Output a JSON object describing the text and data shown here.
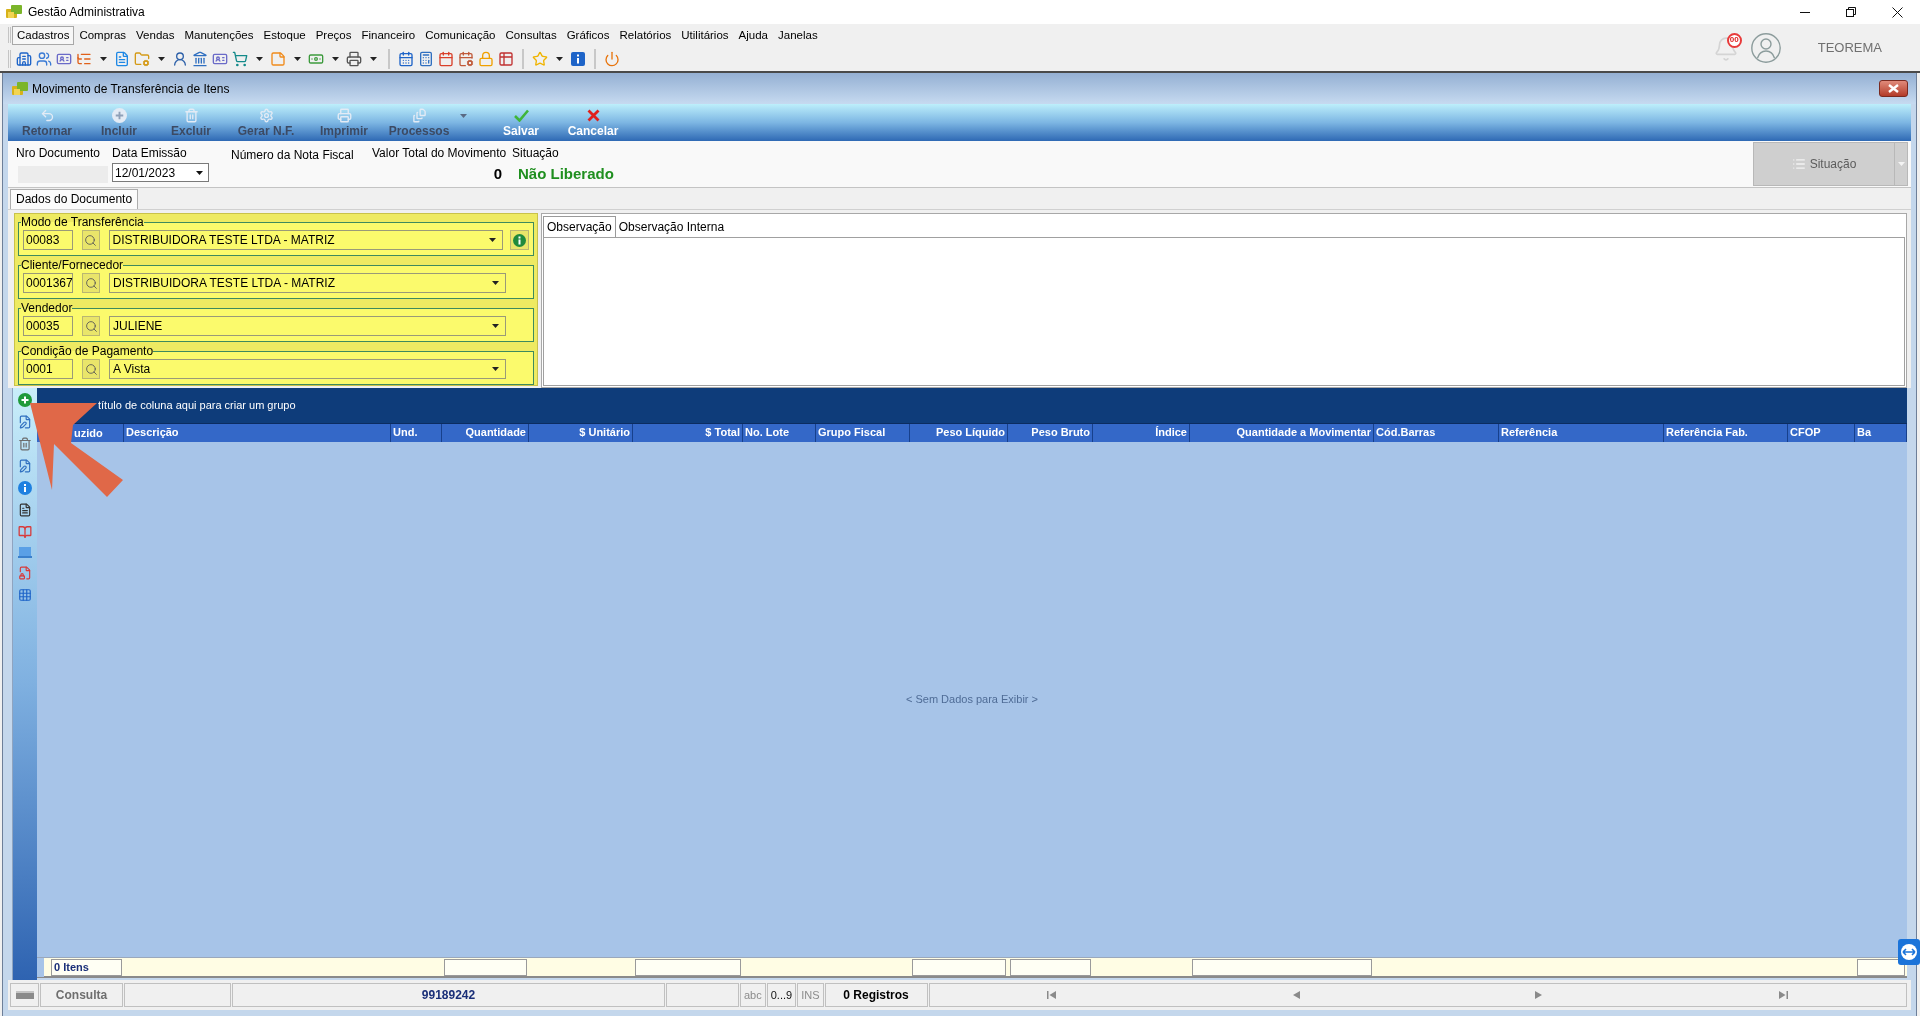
{
  "window": {
    "title": "Gestão Administrativa"
  },
  "menu": [
    {
      "label": "Cadastros",
      "selected": true
    },
    {
      "label": "Compras",
      "selected": false
    },
    {
      "label": "Vendas",
      "selected": false
    },
    {
      "label": "Manutenções",
      "selected": false
    },
    {
      "label": "Estoque",
      "selected": false
    },
    {
      "label": "Preços",
      "selected": false
    },
    {
      "label": "Financeiro",
      "selected": false
    },
    {
      "label": "Comunicação",
      "selected": false
    },
    {
      "label": "Consultas",
      "selected": false
    },
    {
      "label": "Gráficos",
      "selected": false
    },
    {
      "label": "Relatórios",
      "selected": false
    },
    {
      "label": "Utilitários",
      "selected": false
    },
    {
      "label": "Ajuda",
      "selected": false
    },
    {
      "label": "Janelas",
      "selected": false
    }
  ],
  "user_area": {
    "notification_count": "00",
    "user_name": "TEOREMA"
  },
  "document_window": {
    "title": "Movimento de Transferência de Itens",
    "toolbar": [
      {
        "label": "Retornar",
        "kind": "button",
        "disabled": true
      },
      {
        "label": "Incluir",
        "kind": "button",
        "disabled": true
      },
      {
        "label": "Excluir",
        "kind": "button",
        "disabled": true
      },
      {
        "label": "Gerar N.F.",
        "kind": "button",
        "disabled": true
      },
      {
        "label": "Imprimir",
        "kind": "button",
        "disabled": true
      },
      {
        "label": "Processos",
        "kind": "dropdown",
        "disabled": true
      },
      {
        "label": "Salvar",
        "kind": "button",
        "disabled": false
      },
      {
        "label": "Cancelar",
        "kind": "button",
        "disabled": false
      }
    ],
    "header": {
      "document_number": {
        "label": "Nro Documento",
        "disabled": true
      },
      "issue_date": {
        "label": "Data Emissão",
        "value": "12/01/2023"
      },
      "invoice_number": {
        "label": "Número da Nota Fiscal"
      },
      "total_value": {
        "label": "Valor Total do Movimento",
        "value": "0"
      },
      "status": {
        "label": "Situação",
        "value": "Não Liberado"
      },
      "status_button": {
        "label": "Situação",
        "disabled": true
      }
    },
    "tabs": [
      {
        "label": "Dados do Documento",
        "selected": true
      }
    ],
    "groups": [
      {
        "legend": "Modo de Transferência",
        "code": "00083",
        "value": "DISTRIBUIDORA TESTE LTDA - MATRIZ",
        "info": true
      },
      {
        "legend": "Cliente/Fornecedor",
        "code": "0001367",
        "value": "DISTRIBUIDORA TESTE LTDA - MATRIZ",
        "info": false
      },
      {
        "legend": "Vendedor",
        "code": "00035",
        "value": "JULIENE",
        "info": false
      },
      {
        "legend": "Condição de Pagamento",
        "code": "0001",
        "value": "A Vista",
        "info": false
      }
    ],
    "observation_tabs": [
      {
        "label": "Observação",
        "selected": true
      },
      {
        "label": "Observação Interna",
        "selected": false
      }
    ],
    "grid": {
      "group_panel_hint": "título de coluna aqui para criar um grupo",
      "columns": [
        {
          "label": "uzido",
          "summary": true
        },
        {
          "label": "Descrição",
          "summary": false
        },
        {
          "label": "Und.",
          "summary": false
        },
        {
          "label": "Quantidade",
          "summary": true
        },
        {
          "label": "$ Unitário",
          "summary": false
        },
        {
          "label": "$ Total",
          "summary": true
        },
        {
          "label": "No. Lote",
          "summary": false
        },
        {
          "label": "Grupo Fiscal",
          "summary": false
        },
        {
          "label": "Peso Líquido",
          "summary": true
        },
        {
          "label": "Peso Bruto",
          "summary": true
        },
        {
          "label": "Índice",
          "summary": false
        },
        {
          "label": "Quantidade a Movimentar",
          "summary": true
        },
        {
          "label": "Cód.Barras",
          "summary": false
        },
        {
          "label": "Referência",
          "summary": false
        },
        {
          "label": "Referência Fab.",
          "summary": false
        },
        {
          "label": "CFOP",
          "summary": false
        },
        {
          "label": "Ba",
          "summary": true
        }
      ],
      "empty_message": "< Sem Dados para Exibir >",
      "item_count": "0 Itens"
    },
    "status_bar": {
      "mode": "Consulta",
      "code": "99189242",
      "indicators": [
        {
          "label": "abc",
          "on": false
        },
        {
          "label": "0...9",
          "on": true
        },
        {
          "label": "INS",
          "on": false
        }
      ],
      "records": "0 Registros"
    }
  }
}
